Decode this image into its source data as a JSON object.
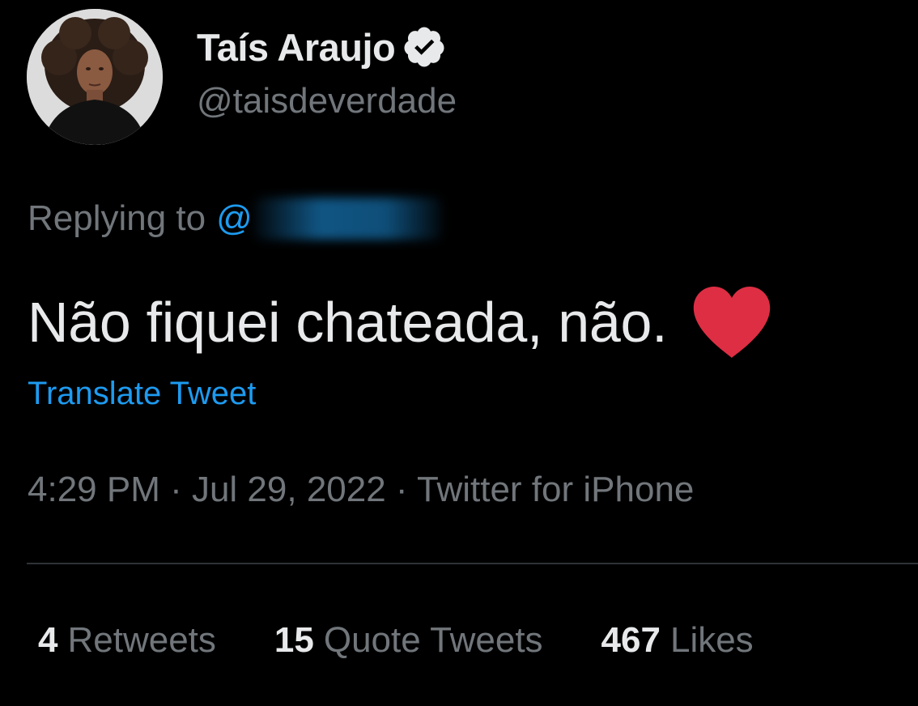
{
  "author": {
    "display_name": "Taís Araujo",
    "handle": "@taisdeverdade",
    "verified_icon": "verified-badge-icon"
  },
  "reply": {
    "prefix": "Replying to",
    "mention_prefix": "@"
  },
  "tweet": {
    "text": "Não fiquei chateada, não.",
    "emoji": "red-heart-icon",
    "translate_label": "Translate Tweet"
  },
  "meta": {
    "time": "4:29 PM",
    "date": "Jul 29, 2022",
    "source": "Twitter for iPhone",
    "line": "4:29 PM · Jul 29, 2022 · Twitter for iPhone"
  },
  "stats": {
    "retweets": {
      "count": "4",
      "label": "Retweets"
    },
    "quote_tweets": {
      "count": "15",
      "label": "Quote Tweets"
    },
    "likes": {
      "count": "467",
      "label": "Likes"
    }
  },
  "colors": {
    "background": "#000000",
    "text": "#e7e9ea",
    "secondary": "#71767b",
    "accent": "#1d9bf0",
    "heart": "#dd2e44",
    "divider": "#2f3336"
  }
}
